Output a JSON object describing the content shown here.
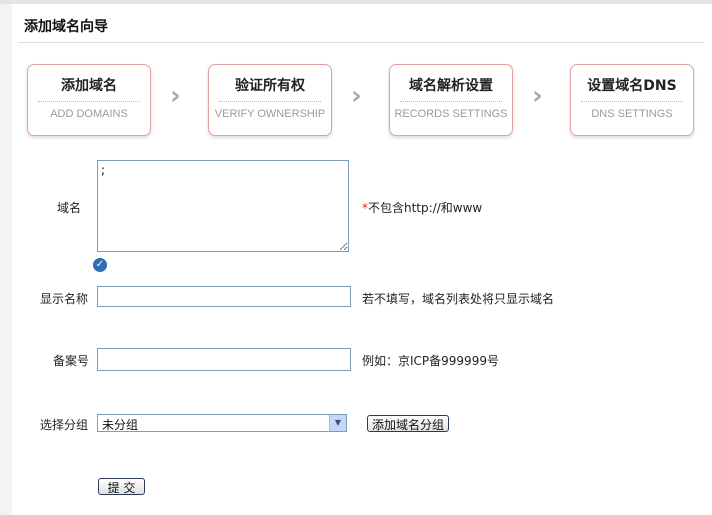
{
  "page": {
    "title": "添加域名向导"
  },
  "steps": [
    {
      "cn": "添加域名",
      "en": "ADD DOMAINS"
    },
    {
      "cn": "验证所有权",
      "en": "VERIFY OWNERSHIP"
    },
    {
      "cn": "域名解析设置",
      "en": "RECORDS SETTINGS"
    },
    {
      "cn": "设置域名DNS",
      "en": "DNS SETTINGS"
    }
  ],
  "form": {
    "domain": {
      "label": "域名",
      "value": ";",
      "required_mark": "*",
      "hint": "不包含http://和www"
    },
    "display_name": {
      "label": "显示名称",
      "value": "",
      "hint": "若不填写，域名列表处将只显示域名"
    },
    "record_no": {
      "label": "备案号",
      "value": "",
      "hint": "例如：京ICP备999999号"
    },
    "group": {
      "label": "选择分组",
      "selected": "未分组",
      "add_button": "添加域名分组"
    },
    "submit_label": "提 交"
  },
  "icons": {
    "check": "check-circle-icon",
    "arrow": "chevron-right-icon",
    "select_arrow": "chevron-down-icon"
  }
}
